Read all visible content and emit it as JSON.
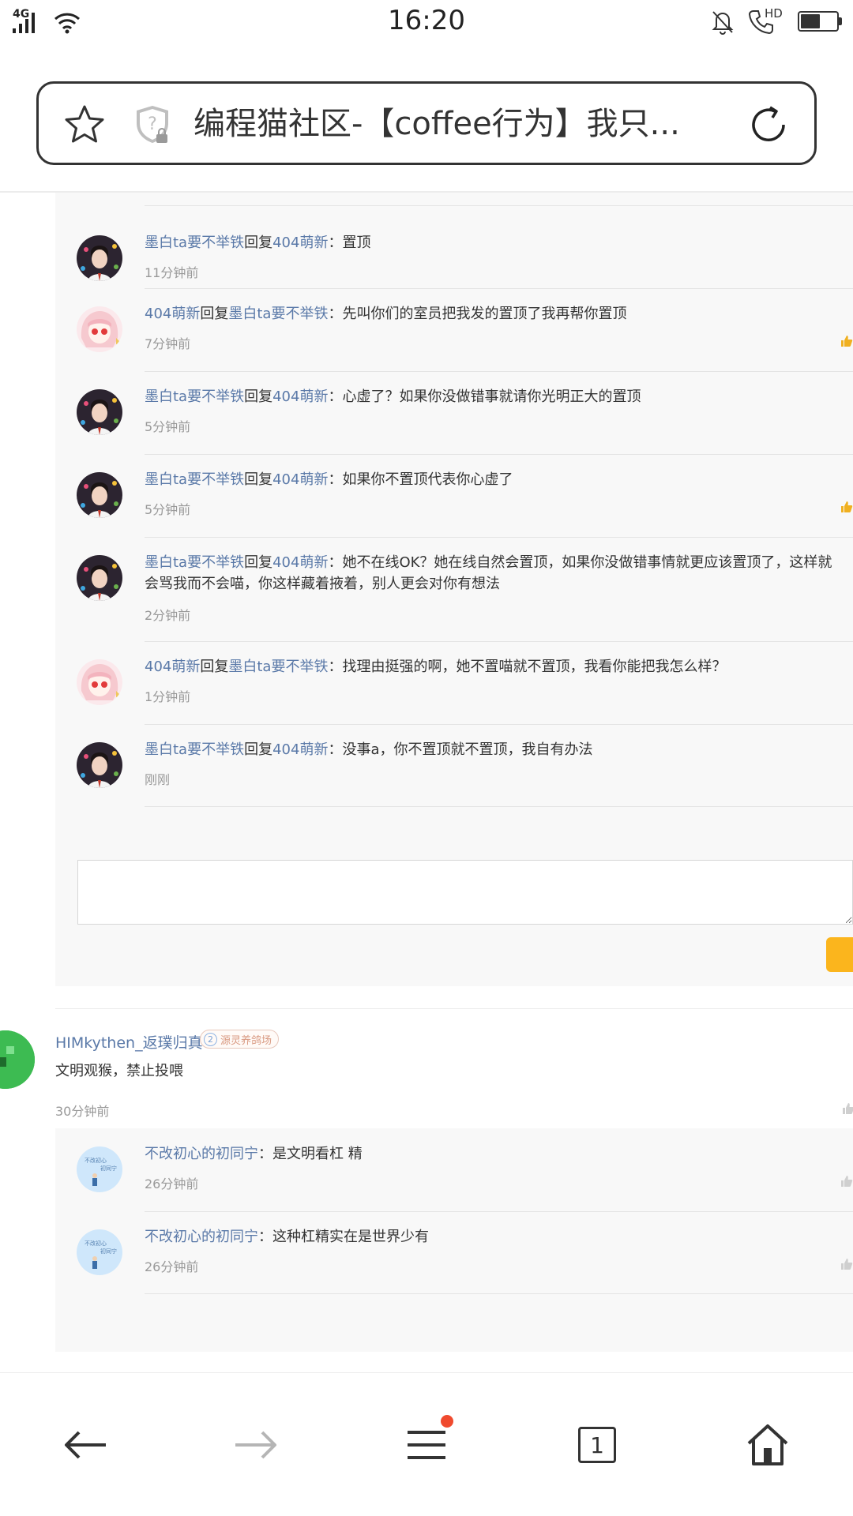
{
  "status_bar": {
    "network": "4G",
    "time": "16:20",
    "call_label": "HD",
    "battery_level": 0.55
  },
  "address_bar": {
    "title": "编程猫社区-【coffee行为】我只..."
  },
  "replies": [
    {
      "user": "墨白ta要不举铁",
      "reply_word": "回复",
      "to": "404萌新",
      "sep": "：",
      "text": "置顶",
      "text2": "",
      "time": "11分钟前",
      "avatar": "boy",
      "liked": false
    },
    {
      "user": "404萌新",
      "reply_word": "回复",
      "to": "墨白ta要不举铁",
      "sep": "：",
      "text": "先叫你们的室员把我发的置顶了我再帮你置顶",
      "text2": "",
      "time": "7分钟前",
      "avatar": "girl",
      "liked": true
    },
    {
      "user": "墨白ta要不举铁",
      "reply_word": "回复",
      "to": "404萌新",
      "sep": "：",
      "text": "心虚了？如果你没做错事就请你光明正大的置顶",
      "text2": "",
      "time": "5分钟前",
      "avatar": "boy",
      "liked": false
    },
    {
      "user": "墨白ta要不举铁",
      "reply_word": "回复",
      "to": "404萌新",
      "sep": "：",
      "text": "如果你不置顶代表你心虚了",
      "text2": "",
      "time": "5分钟前",
      "avatar": "boy",
      "liked": true
    },
    {
      "user": "墨白ta要不举铁",
      "reply_word": "回复",
      "to": "404萌新",
      "sep": "：",
      "text": "她不在线OK？她在线自然会置顶，如果你没做错事情就更应该置顶了，这样就",
      "text2": "会骂我而不会喵，你这样藏着掖着，别人更会对你有想法",
      "time": "2分钟前",
      "avatar": "boy",
      "liked": false
    },
    {
      "user": "404萌新",
      "reply_word": "回复",
      "to": "墨白ta要不举铁",
      "sep": "：",
      "text": "找理由挺强的啊，她不置喵就不置顶，我看你能把我怎么样？",
      "text2": "",
      "time": "1分钟前",
      "avatar": "girl",
      "liked": false
    },
    {
      "user": "墨白ta要不举铁",
      "reply_word": "回复",
      "to": "404萌新",
      "sep": "：",
      "text": "没事a，你不置顶就不置顶，我自有办法",
      "text2": "",
      "time": "刚刚",
      "avatar": "boy",
      "liked": false
    }
  ],
  "comment": {
    "user": "HIMkythen_返璞归真",
    "badge_level": "2",
    "badge_text": "源灵养鸽场",
    "text": "文明观猴，禁止投喂",
    "time": "30分钟前"
  },
  "comment_replies": [
    {
      "user": "不改初心的初同宁",
      "sep": "：",
      "text": "是文明看杠 精",
      "time": "26分钟前"
    },
    {
      "user": "不改初心的初同宁",
      "sep": "：",
      "text": "这种杠精实在是世界少有",
      "time": "26分钟前"
    }
  ],
  "bottom_nav": {
    "tab_count": "1"
  },
  "colors": {
    "link": "#5a79a8",
    "accent": "#fbb51d",
    "notification": "#f04a2e",
    "panel_bg": "#f8f8f8"
  }
}
